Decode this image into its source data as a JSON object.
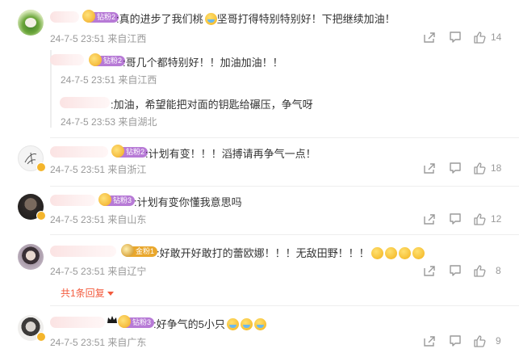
{
  "comments": [
    {
      "badge": "钻粉2",
      "text": ":真的进步了我们桃",
      "text2": "坚哥打得特别特别好！下把继续加油！",
      "date": "24-7-5 23:51",
      "location": "来自江西",
      "likes": "14",
      "replies": [
        {
          "badge": "钻粉2",
          "text": ":哥几个都特别好！！加油加油！！",
          "date": "24-7-5 23:51",
          "location": "来自江西"
        },
        {
          "badge": "",
          "text": ":加油，希望能把对面的钥匙给碾压，争气呀",
          "date": "24-7-5 23:53",
          "location": "来自湖北"
        }
      ]
    },
    {
      "badge": "钻粉2",
      "text": ":计划有变！！！滔搏请再争气一点！",
      "date": "24-7-5 23:51",
      "location": "来自浙江",
      "likes": "18"
    },
    {
      "badge": "钻粉3",
      "text": ":计划有变你懂我意思吗",
      "date": "24-7-5 23:51",
      "location": "来自山东",
      "likes": "12"
    },
    {
      "badge": "金粉1",
      "text": ":好敢开好敢打的蕾欧娜！！！无敌田野！！！",
      "date": "24-7-5 23:51",
      "location": "来自辽宁",
      "likes": "8",
      "more_replies": "共1条回复"
    },
    {
      "badge": "钻粉3",
      "text": ":好争气的5小只",
      "date": "24-7-5 23:51",
      "location": "来自广东",
      "likes": "9"
    }
  ],
  "icons": {
    "share": "share-icon",
    "comment": "comment-icon",
    "like": "thumb-up-icon"
  },
  "colors": {
    "badge_purple": "#b77ad6",
    "badge_gold": "#e9a72c",
    "more_link": "#f35b3e"
  }
}
